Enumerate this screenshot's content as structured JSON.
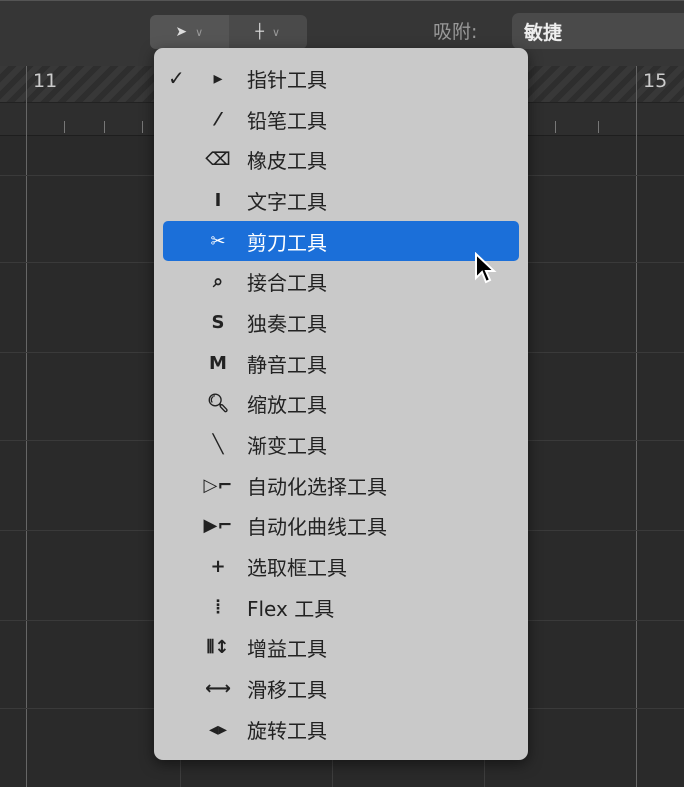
{
  "toolbar": {
    "tool1_icon": "pointer-icon",
    "tool2_icon": "marquee-icon",
    "snap_label": "吸附:",
    "snap_value": "敏捷"
  },
  "ruler": {
    "bar_11": "11",
    "bar_15": "15"
  },
  "menu": {
    "checked": "✓",
    "items": [
      {
        "icon": "▸",
        "name": "pointer",
        "label": "指针工具",
        "checked": true
      },
      {
        "icon": "⁄",
        "name": "pencil",
        "label": "铅笔工具"
      },
      {
        "icon": "⌫",
        "name": "eraser",
        "label": "橡皮工具"
      },
      {
        "icon": "I",
        "name": "text",
        "label": "文字工具"
      },
      {
        "icon": "✂",
        "name": "scissors",
        "label": "剪刀工具",
        "selected": true
      },
      {
        "icon": "⌕",
        "name": "glue",
        "label": "接合工具"
      },
      {
        "icon": "S",
        "name": "solo",
        "label": "独奏工具"
      },
      {
        "icon": "M",
        "name": "mute",
        "label": "静音工具"
      },
      {
        "icon": "🔍︎",
        "name": "zoom",
        "label": "缩放工具"
      },
      {
        "icon": "╲",
        "name": "fade",
        "label": "渐变工具"
      },
      {
        "icon": "▷⌐",
        "name": "automation-select",
        "label": "自动化选择工具"
      },
      {
        "icon": "▶⌐",
        "name": "automation-curve",
        "label": "自动化曲线工具"
      },
      {
        "icon": "+",
        "name": "marquee",
        "label": "选取框工具"
      },
      {
        "icon": "⦙",
        "name": "flex",
        "label": "Flex 工具"
      },
      {
        "icon": "⦀↕",
        "name": "gain",
        "label": "增益工具"
      },
      {
        "icon": "⟷",
        "name": "slip",
        "label": "滑移工具"
      },
      {
        "icon": "◂▸",
        "name": "rotate",
        "label": "旋转工具"
      }
    ]
  }
}
